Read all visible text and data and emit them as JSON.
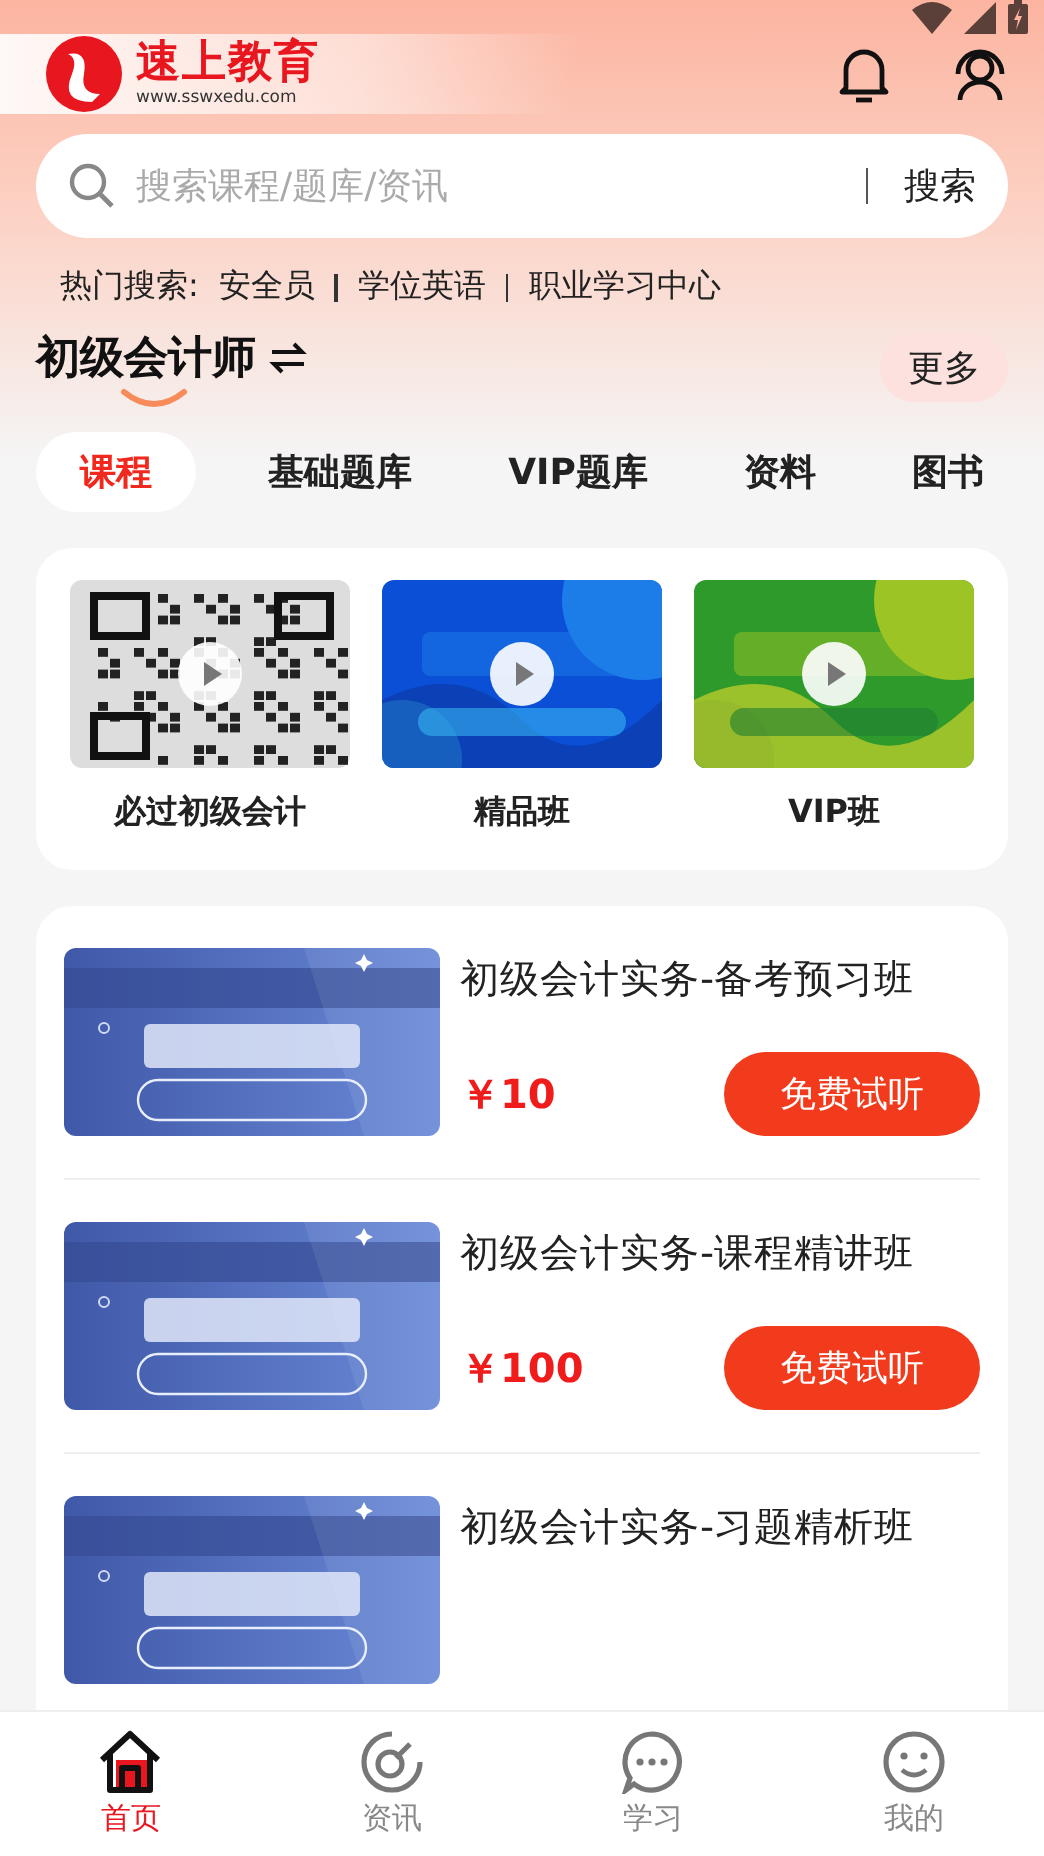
{
  "header": {
    "brand": "速上教育",
    "url": "www.sswxedu.com"
  },
  "search": {
    "placeholder": "搜索课程/题库/资讯",
    "button": "搜索"
  },
  "hot_searches": {
    "label": "热门搜索:",
    "items": [
      "安全员",
      "学位英语",
      "职业学习中心"
    ]
  },
  "subject": {
    "title": "初级会计师",
    "more": "更多"
  },
  "tabs": [
    {
      "label": "课程",
      "selected": true
    },
    {
      "label": "基础题库",
      "selected": false
    },
    {
      "label": "VIP题库",
      "selected": false
    },
    {
      "label": "资料",
      "selected": false
    },
    {
      "label": "图书",
      "selected": false
    }
  ],
  "features": [
    {
      "label": "必过初级会计"
    },
    {
      "label": "精品班"
    },
    {
      "label": "VIP班"
    }
  ],
  "courses": [
    {
      "title": "初级会计实务-备考预习班",
      "price": "￥10",
      "button": "免费试听"
    },
    {
      "title": "初级会计实务-课程精讲班",
      "price": "￥100",
      "button": "免费试听"
    },
    {
      "title": "初级会计实务-习题精析班"
    }
  ],
  "nav": [
    {
      "label": "首页",
      "selected": true
    },
    {
      "label": "资讯",
      "selected": false
    },
    {
      "label": "学习",
      "selected": false
    },
    {
      "label": "我的",
      "selected": false
    }
  ]
}
